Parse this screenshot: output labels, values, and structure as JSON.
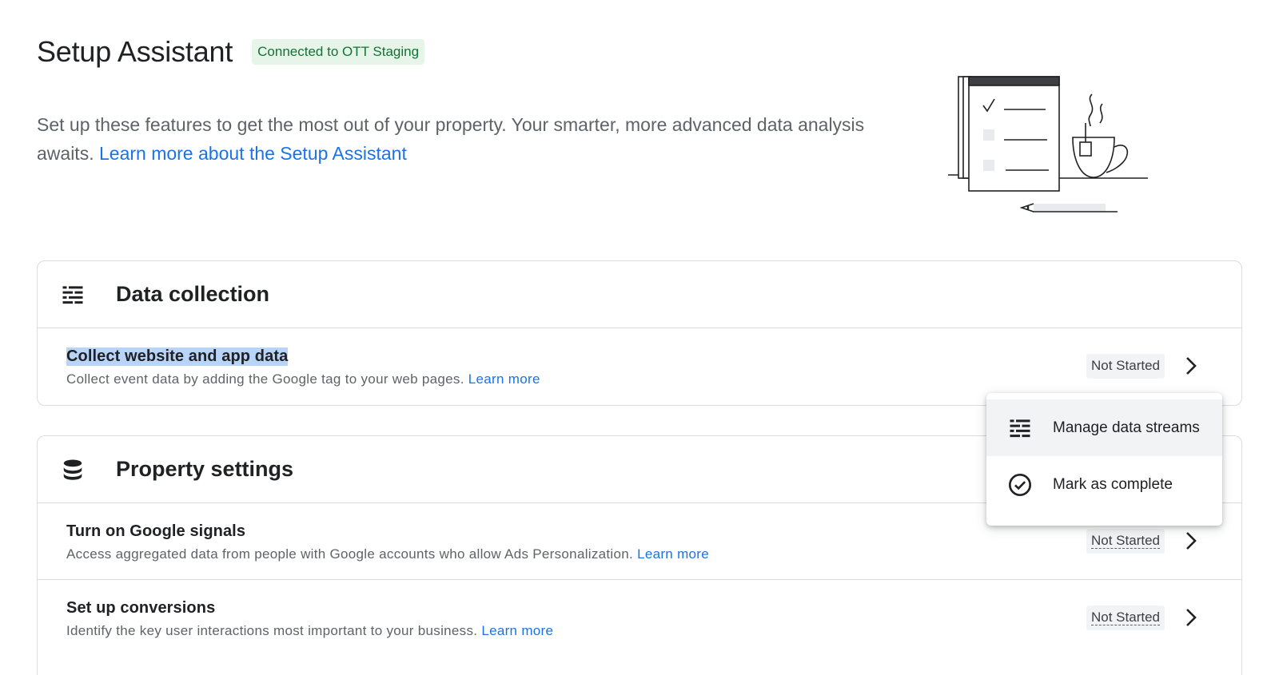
{
  "header": {
    "title": "Setup Assistant",
    "connection_badge": "Connected to OTT Staging"
  },
  "intro": {
    "text": "Set up these features to get the most out of your property. Your smarter, more advanced data analysis awaits.",
    "link": "Learn more about the Setup Assistant"
  },
  "illustration": {
    "icon": "checklist-coffee-illustration"
  },
  "data_collection": {
    "title": "Data collection",
    "icon": "data-streams-icon",
    "rows": [
      {
        "title": "Collect website and app data",
        "description": "Collect event data by adding the Google tag to your web pages.",
        "link": "Learn more",
        "status": "Not Started"
      }
    ]
  },
  "property_settings": {
    "title": "Property settings",
    "icon": "database-icon",
    "rows": [
      {
        "title": "Turn on Google signals",
        "description": "Access aggregated data from people with Google accounts who allow Ads Personalization.",
        "link": "Learn more",
        "status": "Not Started"
      },
      {
        "title": "Set up conversions",
        "description": "Identify the key user interactions most important to your business.",
        "link": "Learn more",
        "status": "Not Started"
      }
    ]
  },
  "context_menu": {
    "items": [
      {
        "label": "Manage data streams",
        "icon": "data-streams-icon"
      },
      {
        "label": "Mark as complete",
        "icon": "check-circle-icon"
      }
    ]
  },
  "colors": {
    "link": "#1a73e8",
    "badge_bg": "#e6f4ea",
    "badge_text": "#137333",
    "selection": "#b9d4f9"
  }
}
